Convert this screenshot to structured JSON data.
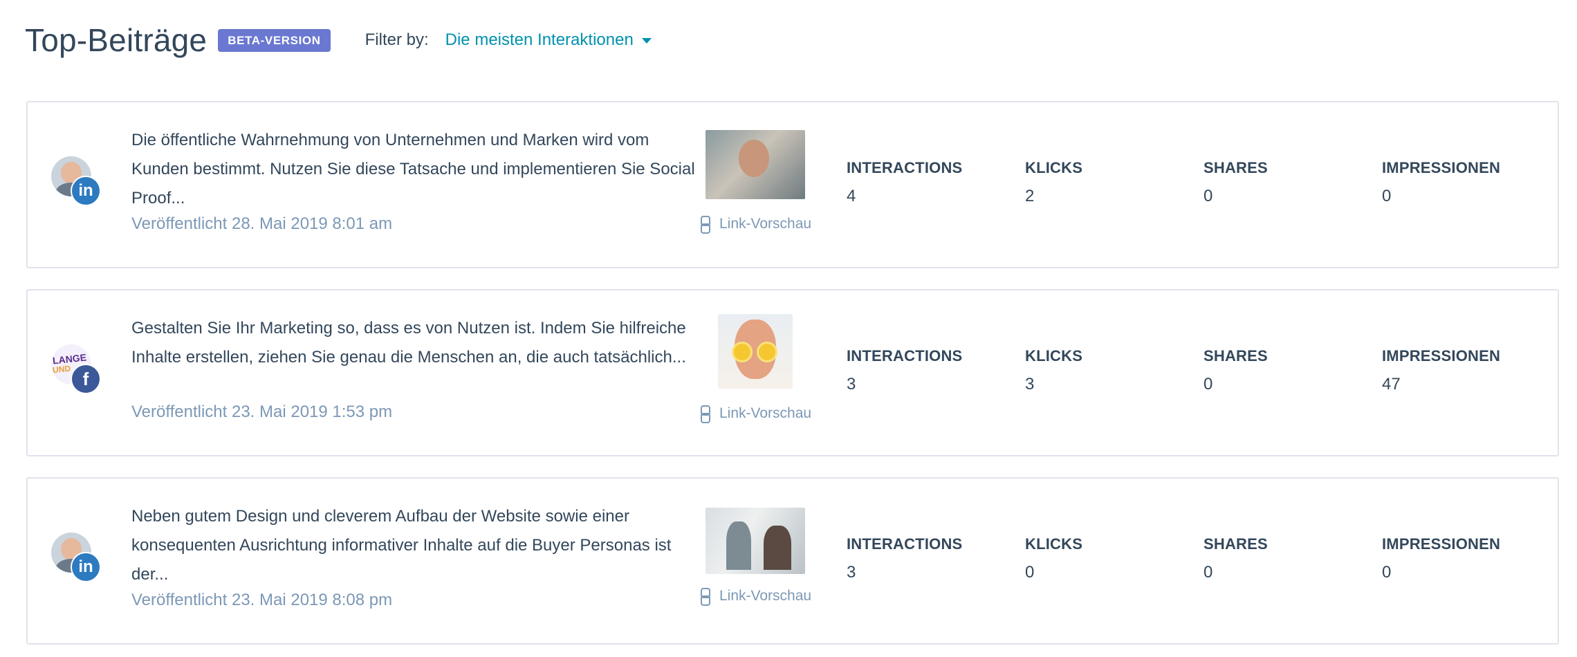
{
  "header": {
    "title": "Top-Beiträge",
    "badge": "BETA-VERSION",
    "filter_label": "Filter by:",
    "filter_value": "Die meisten Interaktionen"
  },
  "metric_labels": {
    "interactions": "INTERACTIONS",
    "clicks": "KLICKS",
    "shares": "SHARES",
    "impressions": "IMPRESSIONEN"
  },
  "link_preview_label": "Link-Vorschau",
  "posts": [
    {
      "network": "linkedin",
      "network_glyph": "in",
      "text": "Die öffentliche Wahrnehmung von Unternehmen und Marken wird vom Kunden bestimmt. Nutzen Sie diese Tatsache und implementieren Sie Social Proof...",
      "date": "Veröffentlicht 28. Mai 2019 8:01 am",
      "interactions": "4",
      "clicks": "2",
      "shares": "0",
      "impressions": "0"
    },
    {
      "network": "facebook",
      "network_glyph": "f",
      "text": "Gestalten Sie Ihr Marketing so, dass es von Nutzen ist. Indem Sie hilfreiche Inhalte erstellen, ziehen Sie genau die Menschen an, die auch tatsächlich...",
      "date": "Veröffentlicht 23. Mai 2019 1:53 pm",
      "interactions": "3",
      "clicks": "3",
      "shares": "0",
      "impressions": "47"
    },
    {
      "network": "linkedin",
      "network_glyph": "in",
      "text": "Neben gutem Design und cleverem Aufbau der Website sowie einer konsequenten Ausrichtung informativer Inhalte auf die Buyer Personas ist der...",
      "date": "Veröffentlicht 23. Mai 2019 8:08 pm",
      "interactions": "3",
      "clicks": "0",
      "shares": "0",
      "impressions": "0"
    }
  ],
  "colors": {
    "text": "#33475b",
    "muted": "#7c98b6",
    "link": "#0091ae",
    "badge": "#6a78d1",
    "linkedin": "#2c7ac0",
    "facebook": "#3b5998",
    "border": "#dfe3eb"
  }
}
